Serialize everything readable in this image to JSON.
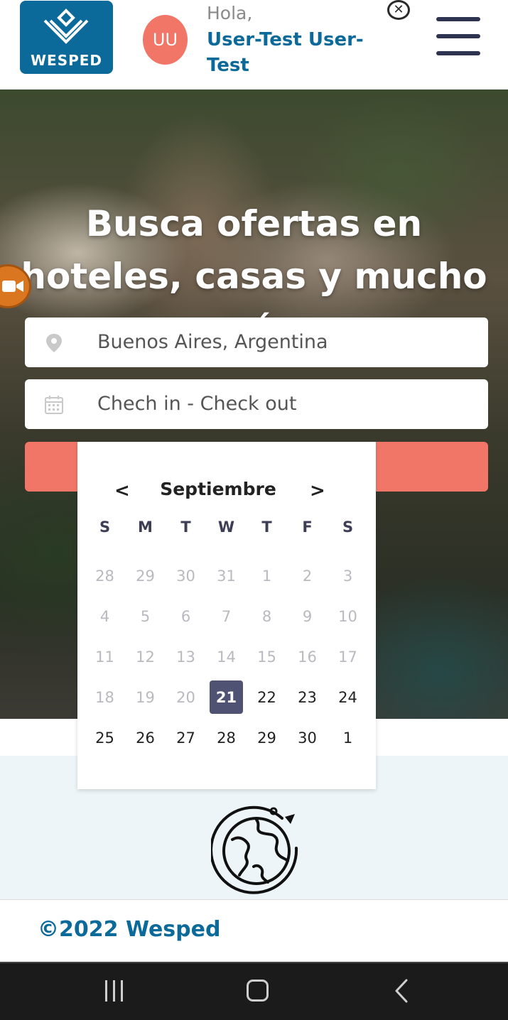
{
  "header": {
    "logo_text": "WESPED",
    "avatar_initials": "UU",
    "greeting": "Hola,",
    "username": "User-Test User-Test",
    "close_glyph": "✕"
  },
  "hero": {
    "title": "Busca ofertas en hoteles, casas y mucho más",
    "destination_value": "Buenos Aires, Argentina",
    "dates_placeholder": "Chech in - Check out"
  },
  "calendar": {
    "prev_label": "<",
    "next_label": ">",
    "month": "Septiembre",
    "weekdays": [
      "S",
      "M",
      "T",
      "W",
      "T",
      "F",
      "S"
    ],
    "days": [
      {
        "d": "28",
        "muted": true
      },
      {
        "d": "29",
        "muted": true
      },
      {
        "d": "30",
        "muted": true
      },
      {
        "d": "31",
        "muted": true
      },
      {
        "d": "1",
        "muted": true
      },
      {
        "d": "2",
        "muted": true
      },
      {
        "d": "3",
        "muted": true
      },
      {
        "d": "4",
        "muted": true
      },
      {
        "d": "5",
        "muted": true
      },
      {
        "d": "6",
        "muted": true
      },
      {
        "d": "7",
        "muted": true
      },
      {
        "d": "8",
        "muted": true
      },
      {
        "d": "9",
        "muted": true
      },
      {
        "d": "10",
        "muted": true
      },
      {
        "d": "11",
        "muted": true
      },
      {
        "d": "12",
        "muted": true
      },
      {
        "d": "13",
        "muted": true
      },
      {
        "d": "14",
        "muted": true
      },
      {
        "d": "15",
        "muted": true
      },
      {
        "d": "16",
        "muted": true
      },
      {
        "d": "17",
        "muted": true
      },
      {
        "d": "18",
        "muted": true
      },
      {
        "d": "19",
        "muted": true
      },
      {
        "d": "20",
        "muted": true
      },
      {
        "d": "21",
        "selected": true
      },
      {
        "d": "22"
      },
      {
        "d": "23"
      },
      {
        "d": "24"
      },
      {
        "d": "25"
      },
      {
        "d": "26"
      },
      {
        "d": "27"
      },
      {
        "d": "28"
      },
      {
        "d": "29"
      },
      {
        "d": "30"
      },
      {
        "d": "1"
      }
    ]
  },
  "footer": {
    "copyright": "©2022 Wesped"
  },
  "colors": {
    "brand_blue": "#0b6a99",
    "accent_coral": "#f27667",
    "selected_day": "#4f5273"
  },
  "icons": [
    "logo-mark-icon",
    "close-icon",
    "menu-icon",
    "video-icon",
    "location-pin-icon",
    "calendar-icon",
    "globe-icon",
    "nav-recent-icon",
    "nav-home-icon",
    "nav-back-icon"
  ]
}
